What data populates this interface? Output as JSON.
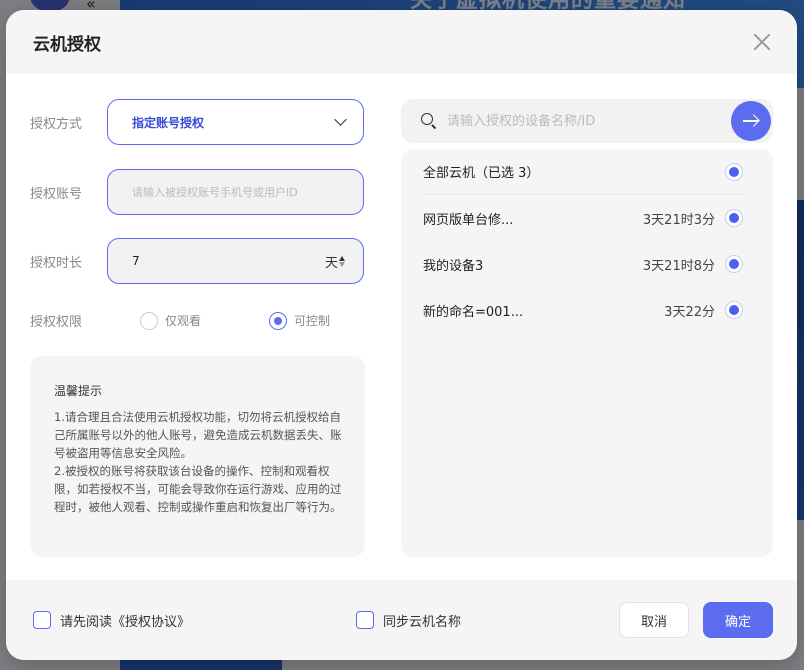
{
  "background": {
    "banner_text": "关于虚拟机使用的重要通知"
  },
  "dialog": {
    "title": "云机授权",
    "form": {
      "auth_mode": {
        "label": "授权方式",
        "value": "指定账号授权"
      },
      "account": {
        "label": "授权账号",
        "value": "",
        "placeholder": "请输入被授权账号手机号或用户ID"
      },
      "duration": {
        "label": "授权时长",
        "value": "7",
        "unit": "天"
      },
      "permission": {
        "label": "授权权限",
        "options": [
          {
            "label": "仅观看",
            "checked": false
          },
          {
            "label": "可控制",
            "checked": true
          }
        ]
      }
    },
    "notice": {
      "title": "温馨提示",
      "lines": [
        "1.请合理且合法使用云机授权功能，切勿将云机授权给自己所属账号以外的他人账号，避免造成云机数据丢失、账号被盗用等信息安全风险。",
        "2.被授权的账号将获取该台设备的操作、控制和观看权限，如若授权不当，可能会导致你在运行游戏、应用的过程时，被他人观看、控制或操作重启和恢复出厂等行为。"
      ]
    },
    "search": {
      "placeholder": "请输入授权的设备名称/ID",
      "value": ""
    },
    "devices": {
      "all": {
        "label": "全部云机（已选 3）",
        "checked": true
      },
      "items": [
        {
          "name": "网页版单台修...",
          "time": "3天21时3分",
          "checked": true
        },
        {
          "name": "我的设备3",
          "time": "3天21时8分",
          "checked": true
        },
        {
          "name": "新的命名=001...",
          "time": "3天22分",
          "checked": true
        }
      ]
    },
    "footer": {
      "agree_label": "请先阅读《授权协议》",
      "sync_label": "同步云机名称",
      "cancel_label": "取消",
      "ok_label": "确定"
    }
  },
  "colors": {
    "accent": "#5b6cf0",
    "panel_bg": "#f5f5f5"
  }
}
